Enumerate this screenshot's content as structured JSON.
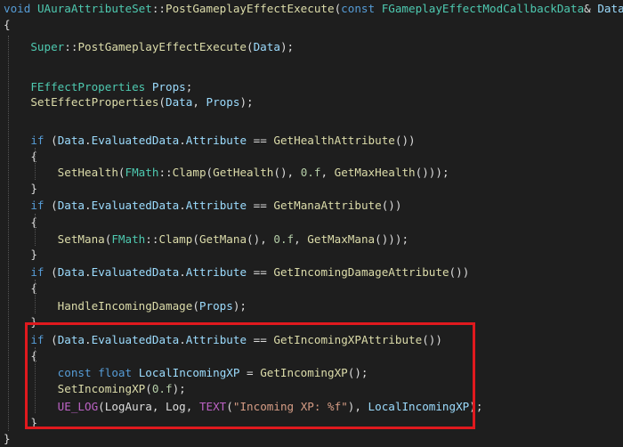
{
  "code_lines": [
    [
      {
        "t": "void",
        "c": "kw"
      },
      {
        "t": " ",
        "c": "plain"
      },
      {
        "t": "UAuraAttributeSet",
        "c": "type"
      },
      {
        "t": "::",
        "c": "plain"
      },
      {
        "t": "PostGameplayEffectExecute",
        "c": "fn"
      },
      {
        "t": "(",
        "c": "plain"
      },
      {
        "t": "const",
        "c": "kw"
      },
      {
        "t": " ",
        "c": "plain"
      },
      {
        "t": "FGameplayEffectModCallbackData",
        "c": "type"
      },
      {
        "t": "& ",
        "c": "plain"
      },
      {
        "t": "Data",
        "c": "var"
      },
      {
        "t": ")",
        "c": "plain"
      }
    ],
    [
      {
        "t": "{",
        "c": "plain"
      }
    ],
    [
      {
        "t": "    ",
        "c": "plain"
      },
      {
        "t": "Super",
        "c": "type"
      },
      {
        "t": "::",
        "c": "plain"
      },
      {
        "t": "PostGameplayEffectExecute",
        "c": "fn"
      },
      {
        "t": "(",
        "c": "plain"
      },
      {
        "t": "Data",
        "c": "var"
      },
      {
        "t": ");",
        "c": "plain"
      }
    ],
    [],
    [
      {
        "t": "    ",
        "c": "plain"
      },
      {
        "t": "FEffectProperties",
        "c": "type"
      },
      {
        "t": " ",
        "c": "plain"
      },
      {
        "t": "Props",
        "c": "var"
      },
      {
        "t": ";",
        "c": "plain"
      }
    ],
    [
      {
        "t": "    ",
        "c": "plain"
      },
      {
        "t": "SetEffectProperties",
        "c": "fn"
      },
      {
        "t": "(",
        "c": "plain"
      },
      {
        "t": "Data",
        "c": "var"
      },
      {
        "t": ", ",
        "c": "plain"
      },
      {
        "t": "Props",
        "c": "var"
      },
      {
        "t": ");",
        "c": "plain"
      }
    ],
    [],
    [
      {
        "t": "    ",
        "c": "plain"
      },
      {
        "t": "if",
        "c": "kw"
      },
      {
        "t": " (",
        "c": "plain"
      },
      {
        "t": "Data",
        "c": "var"
      },
      {
        "t": ".",
        "c": "plain"
      },
      {
        "t": "EvaluatedData",
        "c": "var"
      },
      {
        "t": ".",
        "c": "plain"
      },
      {
        "t": "Attribute",
        "c": "var"
      },
      {
        "t": " == ",
        "c": "plain"
      },
      {
        "t": "GetHealthAttribute",
        "c": "fn"
      },
      {
        "t": "())",
        "c": "plain"
      }
    ],
    [
      {
        "t": "    {",
        "c": "plain"
      }
    ],
    [
      {
        "t": "        ",
        "c": "plain"
      },
      {
        "t": "SetHealth",
        "c": "fn"
      },
      {
        "t": "(",
        "c": "plain"
      },
      {
        "t": "FMath",
        "c": "type"
      },
      {
        "t": "::",
        "c": "plain"
      },
      {
        "t": "Clamp",
        "c": "fn"
      },
      {
        "t": "(",
        "c": "plain"
      },
      {
        "t": "GetHealth",
        "c": "fn"
      },
      {
        "t": "(), ",
        "c": "plain"
      },
      {
        "t": "0.f",
        "c": "num"
      },
      {
        "t": ", ",
        "c": "plain"
      },
      {
        "t": "GetMaxHealth",
        "c": "fn"
      },
      {
        "t": "()));",
        "c": "plain"
      }
    ],
    [
      {
        "t": "    }",
        "c": "plain"
      }
    ],
    [
      {
        "t": "    ",
        "c": "plain"
      },
      {
        "t": "if",
        "c": "kw"
      },
      {
        "t": " (",
        "c": "plain"
      },
      {
        "t": "Data",
        "c": "var"
      },
      {
        "t": ".",
        "c": "plain"
      },
      {
        "t": "EvaluatedData",
        "c": "var"
      },
      {
        "t": ".",
        "c": "plain"
      },
      {
        "t": "Attribute",
        "c": "var"
      },
      {
        "t": " == ",
        "c": "plain"
      },
      {
        "t": "GetManaAttribute",
        "c": "fn"
      },
      {
        "t": "())",
        "c": "plain"
      }
    ],
    [
      {
        "t": "    {",
        "c": "plain"
      }
    ],
    [
      {
        "t": "        ",
        "c": "plain"
      },
      {
        "t": "SetMana",
        "c": "fn"
      },
      {
        "t": "(",
        "c": "plain"
      },
      {
        "t": "FMath",
        "c": "type"
      },
      {
        "t": "::",
        "c": "plain"
      },
      {
        "t": "Clamp",
        "c": "fn"
      },
      {
        "t": "(",
        "c": "plain"
      },
      {
        "t": "GetMana",
        "c": "fn"
      },
      {
        "t": "(), ",
        "c": "plain"
      },
      {
        "t": "0.f",
        "c": "num"
      },
      {
        "t": ", ",
        "c": "plain"
      },
      {
        "t": "GetMaxMana",
        "c": "fn"
      },
      {
        "t": "()));",
        "c": "plain"
      }
    ],
    [
      {
        "t": "    }",
        "c": "plain"
      }
    ],
    [
      {
        "t": "    ",
        "c": "plain"
      },
      {
        "t": "if",
        "c": "kw"
      },
      {
        "t": " (",
        "c": "plain"
      },
      {
        "t": "Data",
        "c": "var"
      },
      {
        "t": ".",
        "c": "plain"
      },
      {
        "t": "EvaluatedData",
        "c": "var"
      },
      {
        "t": ".",
        "c": "plain"
      },
      {
        "t": "Attribute",
        "c": "var"
      },
      {
        "t": " == ",
        "c": "plain"
      },
      {
        "t": "GetIncomingDamageAttribute",
        "c": "fn"
      },
      {
        "t": "())",
        "c": "plain"
      }
    ],
    [
      {
        "t": "    {",
        "c": "plain"
      }
    ],
    [
      {
        "t": "        ",
        "c": "plain"
      },
      {
        "t": "HandleIncomingDamage",
        "c": "fn"
      },
      {
        "t": "(",
        "c": "plain"
      },
      {
        "t": "Props",
        "c": "var"
      },
      {
        "t": ");",
        "c": "plain"
      }
    ],
    [
      {
        "t": "    }",
        "c": "plain"
      }
    ],
    [
      {
        "t": "    ",
        "c": "plain"
      },
      {
        "t": "if",
        "c": "kw"
      },
      {
        "t": " (",
        "c": "plain"
      },
      {
        "t": "Data",
        "c": "var"
      },
      {
        "t": ".",
        "c": "plain"
      },
      {
        "t": "EvaluatedData",
        "c": "var"
      },
      {
        "t": ".",
        "c": "plain"
      },
      {
        "t": "Attribute",
        "c": "var"
      },
      {
        "t": " == ",
        "c": "plain"
      },
      {
        "t": "GetIncomingXPAttribute",
        "c": "fn"
      },
      {
        "t": "())",
        "c": "plain"
      }
    ],
    [
      {
        "t": "    {",
        "c": "plain"
      }
    ],
    [
      {
        "t": "        ",
        "c": "plain"
      },
      {
        "t": "const",
        "c": "kw"
      },
      {
        "t": " ",
        "c": "plain"
      },
      {
        "t": "float",
        "c": "kw"
      },
      {
        "t": " ",
        "c": "plain"
      },
      {
        "t": "LocalIncomingXP",
        "c": "var"
      },
      {
        "t": " = ",
        "c": "plain"
      },
      {
        "t": "GetIncomingXP",
        "c": "fn"
      },
      {
        "t": "();",
        "c": "plain"
      }
    ],
    [
      {
        "t": "        ",
        "c": "plain"
      },
      {
        "t": "SetIncomingXP",
        "c": "fn"
      },
      {
        "t": "(",
        "c": "plain"
      },
      {
        "t": "0.f",
        "c": "num"
      },
      {
        "t": ");",
        "c": "plain"
      }
    ],
    [
      {
        "t": "        ",
        "c": "plain"
      },
      {
        "t": "UE_LOG",
        "c": "macro"
      },
      {
        "t": "(",
        "c": "plain"
      },
      {
        "t": "LogAura",
        "c": "plain"
      },
      {
        "t": ", ",
        "c": "plain"
      },
      {
        "t": "Log",
        "c": "plain"
      },
      {
        "t": ", ",
        "c": "plain"
      },
      {
        "t": "TEXT",
        "c": "macro"
      },
      {
        "t": "(",
        "c": "plain"
      },
      {
        "t": "\"Incoming XP: %f\"",
        "c": "str"
      },
      {
        "t": "), ",
        "c": "plain"
      },
      {
        "t": "LocalIncomingXP",
        "c": "var"
      },
      {
        "t": ");",
        "c": "plain"
      }
    ],
    [
      {
        "t": "    }",
        "c": "plain"
      }
    ],
    [
      {
        "t": "}",
        "c": "plain"
      }
    ]
  ],
  "colors": {
    "background": "#1e1e1e",
    "highlight_border": "#e0191e",
    "keyword": "#569cd6",
    "type": "#4ec9b0",
    "function": "#dcdcaa",
    "variable": "#9cdcfe",
    "string": "#d69d85",
    "number": "#b5cea8",
    "macro": "#bd63c5",
    "plain": "#dcdcdc"
  }
}
